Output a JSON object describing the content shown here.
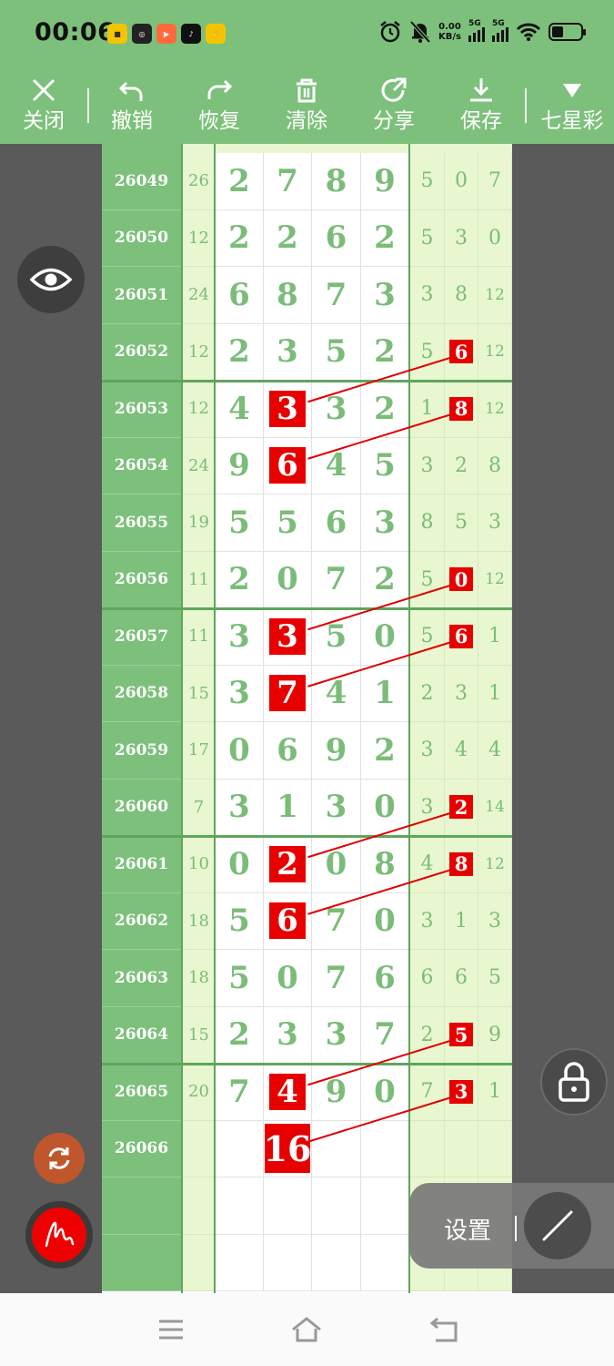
{
  "status_bar": {
    "time": "00:06",
    "net_speed_value": "0.00",
    "net_speed_unit": "KB/s",
    "signal1_label": "5G",
    "signal2_label": "5G",
    "app_icons": [
      "meituan-icon",
      "app-icon-2",
      "video-app-icon",
      "tiktok-icon",
      "hand-app-icon"
    ]
  },
  "toolbar": {
    "close_label": "关闭",
    "undo_label": "撤销",
    "redo_label": "恢复",
    "clear_label": "清除",
    "share_label": "分享",
    "save_label": "保存",
    "lottery_label": "七星彩"
  },
  "grid": {
    "rows": [
      {
        "issue": "26049",
        "sum": "26",
        "digits": [
          "2",
          "7",
          "8",
          "9"
        ],
        "tails": [
          "5",
          "0",
          "7"
        ]
      },
      {
        "issue": "26050",
        "sum": "12",
        "digits": [
          "2",
          "2",
          "6",
          "2"
        ],
        "tails": [
          "5",
          "3",
          "0"
        ]
      },
      {
        "issue": "26051",
        "sum": "24",
        "digits": [
          "6",
          "8",
          "7",
          "3"
        ],
        "tails": [
          "3",
          "8",
          "12"
        ]
      },
      {
        "issue": "26052",
        "sum": "12",
        "digits": [
          "2",
          "3",
          "5",
          "2"
        ],
        "tails": [
          "5",
          "6",
          "12"
        ]
      },
      {
        "issue": "26053",
        "sum": "12",
        "digits": [
          "4",
          "3",
          "3",
          "2"
        ],
        "tails": [
          "1",
          "8",
          "12"
        ]
      },
      {
        "issue": "26054",
        "sum": "24",
        "digits": [
          "9",
          "6",
          "4",
          "5"
        ],
        "tails": [
          "3",
          "2",
          "8"
        ]
      },
      {
        "issue": "26055",
        "sum": "19",
        "digits": [
          "5",
          "5",
          "6",
          "3"
        ],
        "tails": [
          "8",
          "5",
          "3"
        ]
      },
      {
        "issue": "26056",
        "sum": "11",
        "digits": [
          "2",
          "0",
          "7",
          "2"
        ],
        "tails": [
          "5",
          "0",
          "12"
        ]
      },
      {
        "issue": "26057",
        "sum": "11",
        "digits": [
          "3",
          "3",
          "5",
          "0"
        ],
        "tails": [
          "5",
          "6",
          "1"
        ]
      },
      {
        "issue": "26058",
        "sum": "15",
        "digits": [
          "3",
          "7",
          "4",
          "1"
        ],
        "tails": [
          "2",
          "3",
          "1"
        ]
      },
      {
        "issue": "26059",
        "sum": "17",
        "digits": [
          "0",
          "6",
          "9",
          "2"
        ],
        "tails": [
          "3",
          "4",
          "4"
        ]
      },
      {
        "issue": "26060",
        "sum": "7",
        "digits": [
          "3",
          "1",
          "3",
          "0"
        ],
        "tails": [
          "3",
          "2",
          "14"
        ]
      },
      {
        "issue": "26061",
        "sum": "10",
        "digits": [
          "0",
          "2",
          "0",
          "8"
        ],
        "tails": [
          "4",
          "8",
          "12"
        ]
      },
      {
        "issue": "26062",
        "sum": "18",
        "digits": [
          "5",
          "6",
          "7",
          "0"
        ],
        "tails": [
          "3",
          "1",
          "3"
        ]
      },
      {
        "issue": "26063",
        "sum": "18",
        "digits": [
          "5",
          "0",
          "7",
          "6"
        ],
        "tails": [
          "6",
          "6",
          "5"
        ]
      },
      {
        "issue": "26064",
        "sum": "15",
        "digits": [
          "2",
          "3",
          "3",
          "7"
        ],
        "tails": [
          "2",
          "5",
          "9"
        ]
      },
      {
        "issue": "26065",
        "sum": "20",
        "digits": [
          "7",
          "4",
          "9",
          "0"
        ],
        "tails": [
          "7",
          "3",
          "1"
        ]
      },
      {
        "issue": "26066",
        "sum": "",
        "digits": [
          "",
          "16",
          "",
          ""
        ],
        "tails": [
          "",
          "",
          ""
        ]
      },
      {
        "issue": "",
        "sum": "",
        "digits": [
          "",
          "",
          "",
          ""
        ],
        "tails": [
          "",
          "",
          ""
        ]
      },
      {
        "issue": "",
        "sum": "",
        "digits": [
          "",
          "",
          "",
          ""
        ],
        "tails": [
          "",
          "",
          ""
        ]
      }
    ],
    "highlight_main": [
      4,
      5,
      8,
      9,
      12,
      13,
      16
    ],
    "highlight_tail": [
      3,
      4,
      7,
      8,
      11,
      12,
      15,
      16
    ],
    "highlight_big_row": 17,
    "line_color": "#e00000",
    "accent_color": "#7dc07b"
  },
  "controls": {
    "settings_label": "设置",
    "settings_separator": "|"
  }
}
